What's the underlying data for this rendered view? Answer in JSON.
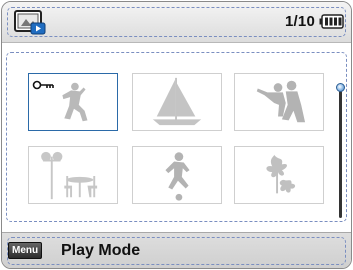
{
  "header": {
    "mode_icon": "play-mode-icon",
    "counter": "1/10",
    "battery_icon": "battery-icon"
  },
  "thumbnails": [
    {
      "icon": "protected-key-icon",
      "subject": "dancing-person",
      "selected": true
    },
    {
      "subject": "sailboat",
      "selected": false
    },
    {
      "subject": "couple-pointing",
      "selected": false
    },
    {
      "subject": "cafe-table-lamp",
      "selected": false
    },
    {
      "subject": "soccer-player",
      "selected": false
    },
    {
      "subject": "flowers",
      "selected": false
    }
  ],
  "scrollbar": {
    "position": 0
  },
  "footer": {
    "menu_label": "Menu",
    "mode_label": "Play Mode"
  },
  "colors": {
    "accent": "#2b6aa8",
    "dash": "#7a8ec0",
    "silhouette": "#b9b9b9"
  }
}
